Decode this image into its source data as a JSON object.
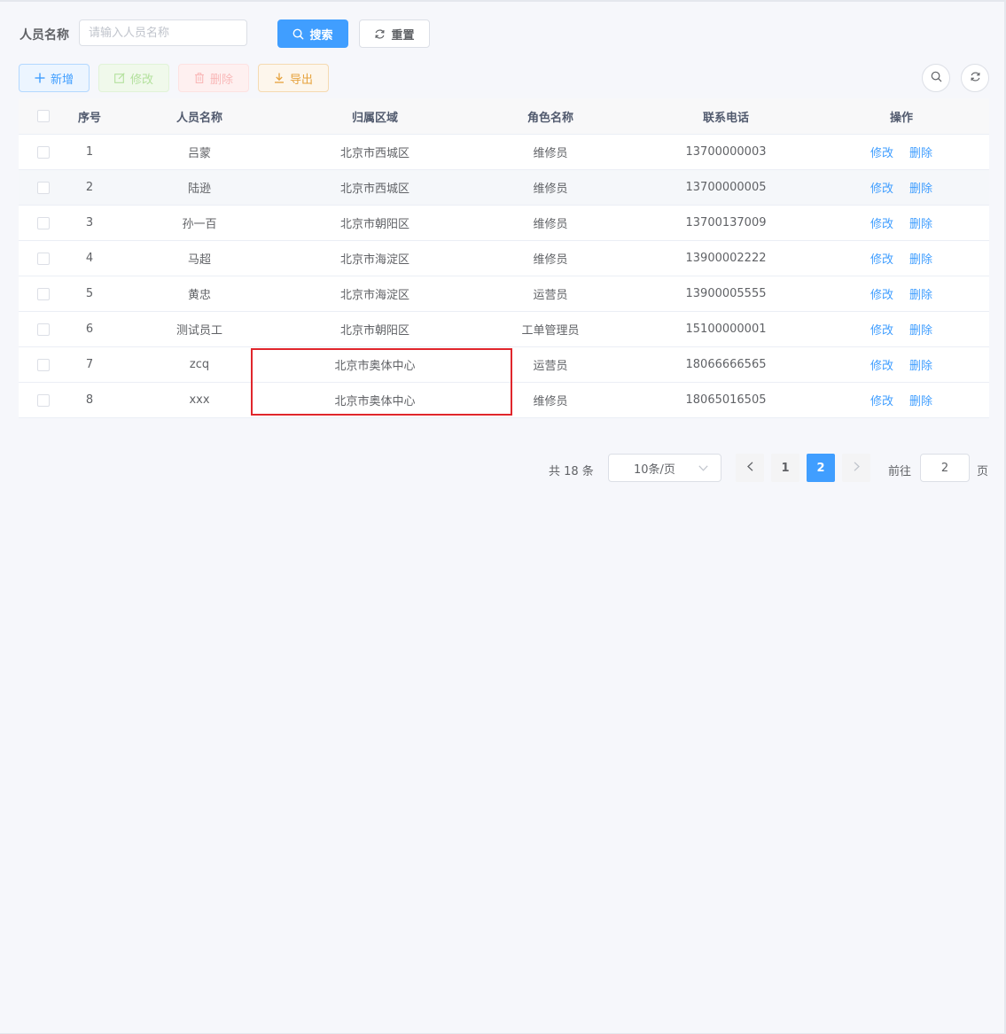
{
  "search": {
    "label": "人员名称",
    "placeholder": "请输入人员名称",
    "value": "",
    "search_label": "搜索",
    "reset_label": "重置"
  },
  "toolbar": {
    "add_label": "新增",
    "edit_label": "修改",
    "delete_label": "删除",
    "export_label": "导出"
  },
  "table": {
    "headers": {
      "index": "序号",
      "name": "人员名称",
      "area": "归属区域",
      "role": "角色名称",
      "phone": "联系电话",
      "ops": "操作"
    },
    "rows": [
      {
        "index": "1",
        "name": "吕蒙",
        "area": "北京市西城区",
        "role": "维修员",
        "phone": "13700000003",
        "edit": "修改",
        "delete": "删除"
      },
      {
        "index": "2",
        "name": "陆逊",
        "area": "北京市西城区",
        "role": "维修员",
        "phone": "13700000005",
        "edit": "修改",
        "delete": "删除"
      },
      {
        "index": "3",
        "name": "孙一百",
        "area": "北京市朝阳区",
        "role": "维修员",
        "phone": "13700137009",
        "edit": "修改",
        "delete": "删除"
      },
      {
        "index": "4",
        "name": "马超",
        "area": "北京市海淀区",
        "role": "维修员",
        "phone": "13900002222",
        "edit": "修改",
        "delete": "删除"
      },
      {
        "index": "5",
        "name": "黄忠",
        "area": "北京市海淀区",
        "role": "运营员",
        "phone": "13900005555",
        "edit": "修改",
        "delete": "删除"
      },
      {
        "index": "6",
        "name": "测试员工",
        "area": "北京市朝阳区",
        "role": "工单管理员",
        "phone": "15100000001",
        "edit": "修改",
        "delete": "删除"
      },
      {
        "index": "7",
        "name": "zcq",
        "area": "北京市奥体中心",
        "role": "运营员",
        "phone": "18066666565",
        "edit": "修改",
        "delete": "删除"
      },
      {
        "index": "8",
        "name": "xxx",
        "area": "北京市奥体中心",
        "role": "维修员",
        "phone": "18065016505",
        "edit": "修改",
        "delete": "删除"
      }
    ]
  },
  "pagination": {
    "total_text": "共 18 条",
    "page_size": "10条/页",
    "pages": [
      "1",
      "2"
    ],
    "current_page": "2",
    "goto_label": "前往",
    "goto_value": "2",
    "goto_suffix": "页"
  },
  "colors": {
    "primary": "#409eff",
    "highlight_box": "#e0262c"
  },
  "icons": {
    "search_button_icon": "search-icon",
    "reset_button_icon": "refresh-icon",
    "add_icon": "plus-icon",
    "edit_icon": "edit-icon",
    "delete_icon": "trash-icon",
    "export_icon": "download-icon"
  }
}
